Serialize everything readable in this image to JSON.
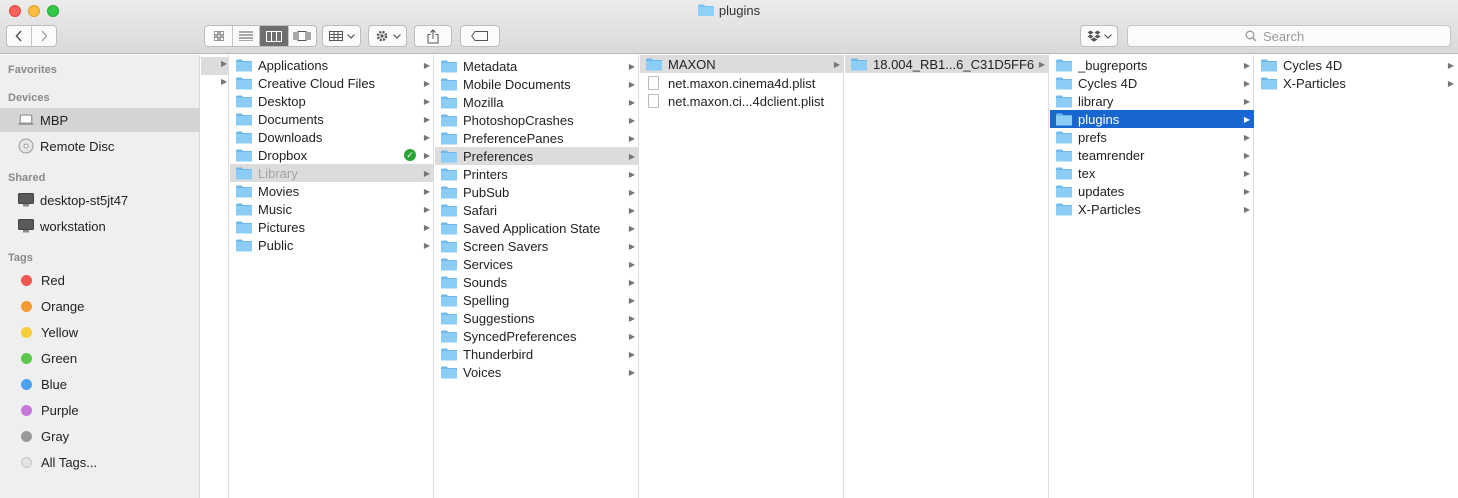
{
  "window": {
    "title": "plugins"
  },
  "toolbar": {
    "search_placeholder": "Search"
  },
  "sidebar": {
    "favorites_label": "Favorites",
    "devices_label": "Devices",
    "shared_label": "Shared",
    "tags_label": "Tags",
    "devices": [
      {
        "label": "MBP",
        "icon": "laptop-icon"
      },
      {
        "label": "Remote Disc",
        "icon": "disc-icon"
      }
    ],
    "shared": [
      {
        "label": "desktop-st5jt47",
        "icon": "display-icon"
      },
      {
        "label": "workstation",
        "icon": "display-icon"
      }
    ],
    "tags": [
      {
        "label": "Red",
        "color": "#f2574f"
      },
      {
        "label": "Orange",
        "color": "#f39a33"
      },
      {
        "label": "Yellow",
        "color": "#f6cf3b"
      },
      {
        "label": "Green",
        "color": "#5ac84b"
      },
      {
        "label": "Blue",
        "color": "#4aa3f0"
      },
      {
        "label": "Purple",
        "color": "#c776d9"
      },
      {
        "label": "Gray",
        "color": "#9a9a9a"
      },
      {
        "label": "All Tags...",
        "color": "#e3e3e3"
      }
    ]
  },
  "columns": {
    "home": [
      "Applications",
      "Creative Cloud Files",
      "Desktop",
      "Documents",
      "Downloads",
      "Dropbox",
      "Library",
      "Movies",
      "Music",
      "Pictures",
      "Public"
    ],
    "library": [
      "Metadata",
      "Mobile Documents",
      "Mozilla",
      "PhotoshopCrashes",
      "PreferencePanes",
      "Preferences",
      "Printers",
      "PubSub",
      "Safari",
      "Saved Application State",
      "Screen Savers",
      "Services",
      "Sounds",
      "Spelling",
      "Suggestions",
      "SyncedPreferences",
      "Thunderbird",
      "Voices"
    ],
    "preferences": {
      "folder": "MAXON",
      "files": [
        "net.maxon.cinema4d.plist",
        "net.maxon.ci...4dclient.plist"
      ]
    },
    "maxon": [
      "18.004_RB1...6_C31D5FF6"
    ],
    "version": [
      "_bugreports",
      "Cycles 4D",
      "library",
      "plugins",
      "prefs",
      "teamrender",
      "tex",
      "updates",
      "X-Particles"
    ],
    "plugins": [
      "Cycles 4D",
      "X-Particles"
    ]
  }
}
